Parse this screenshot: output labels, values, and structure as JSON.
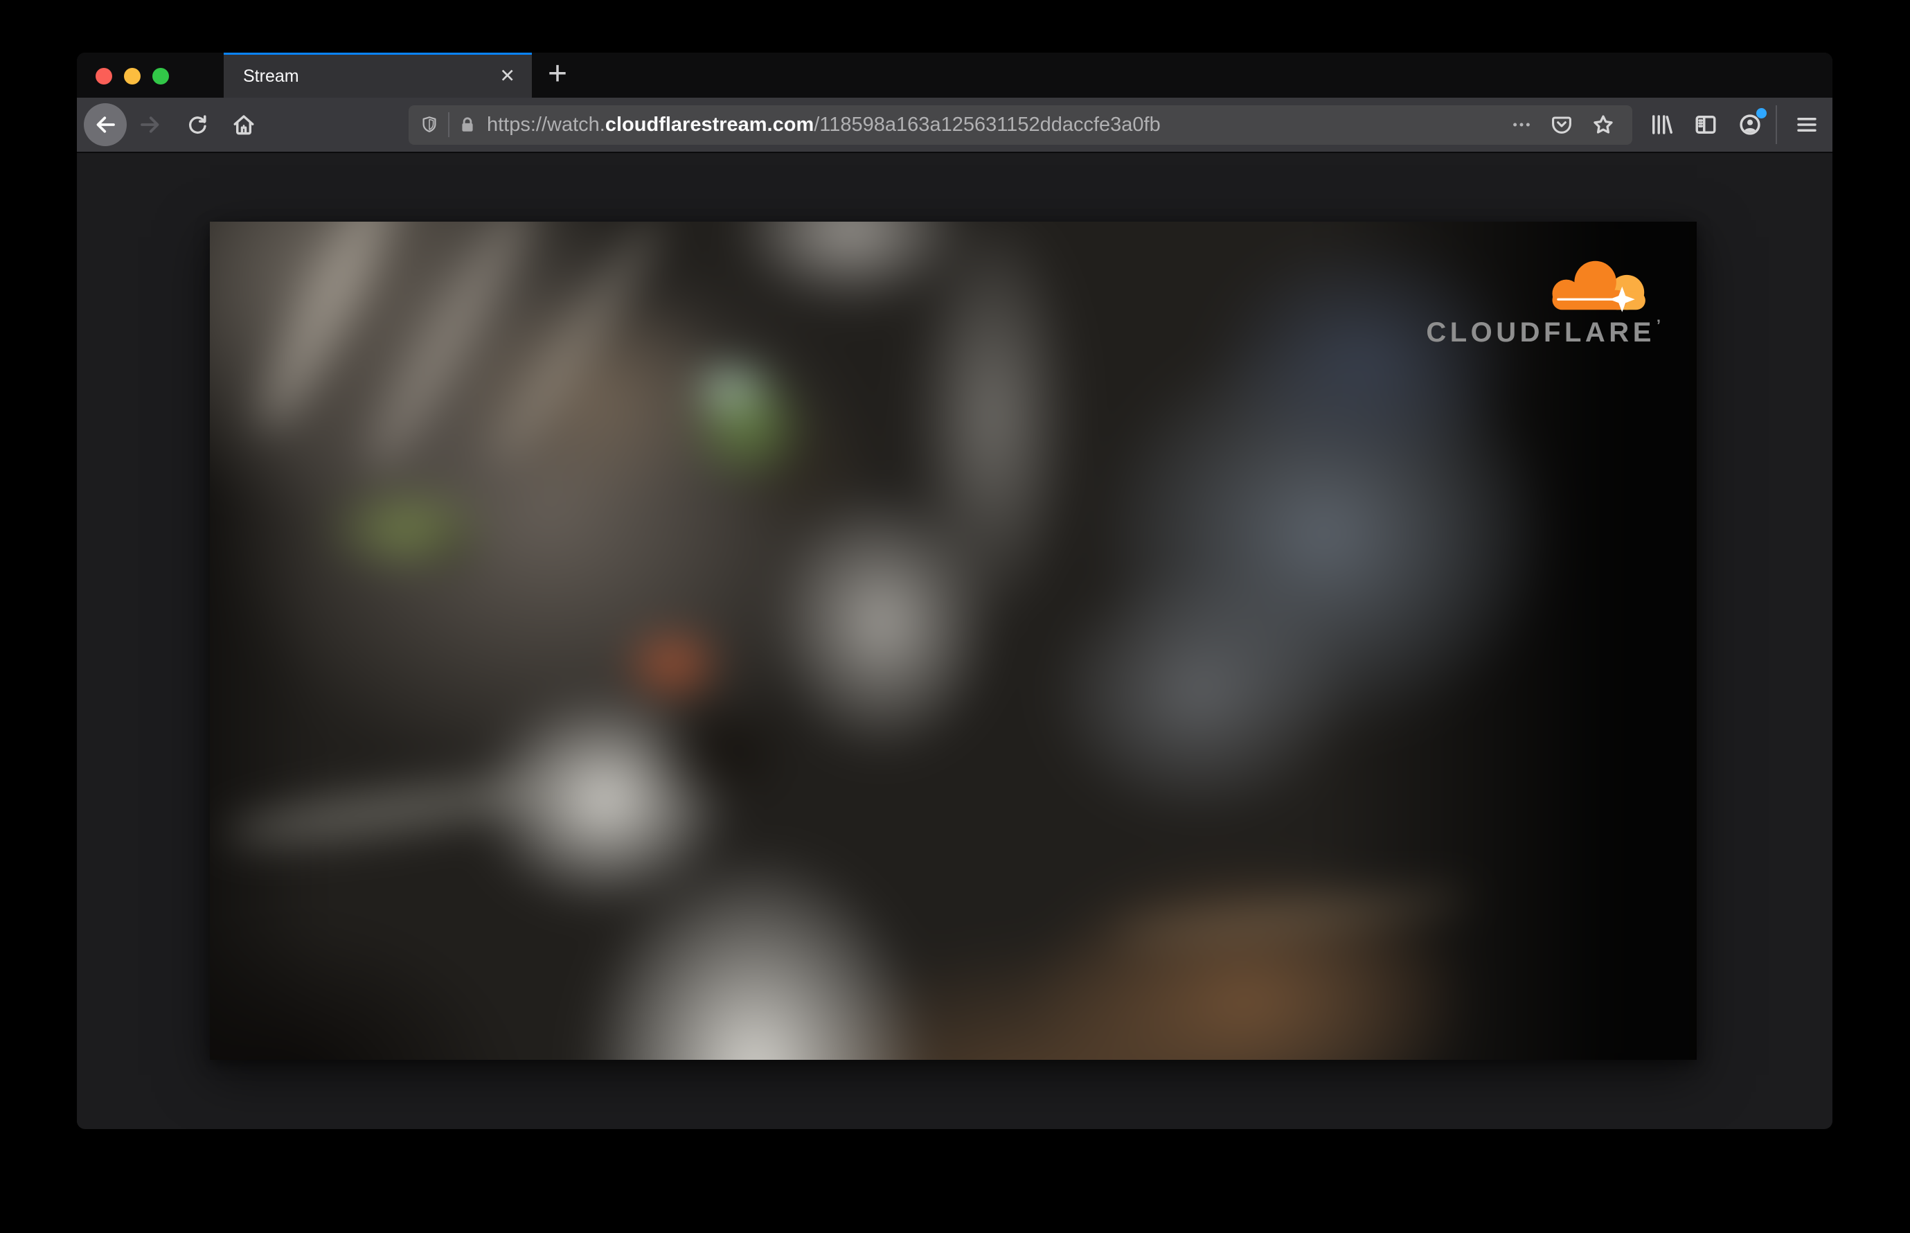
{
  "browser": {
    "tab": {
      "title": "Stream",
      "close_glyph": "✕",
      "new_tab_glyph": "+"
    },
    "address_bar": {
      "url_prefix": "https://watch.",
      "url_domain": "cloudflarestream.com",
      "url_path": "/118598a163a125631152ddaccfe3a0fb"
    },
    "icons": [
      "back-icon",
      "forward-icon",
      "reload-icon",
      "home-icon",
      "shield-icon",
      "lock-icon",
      "page-actions-dots-icon",
      "pocket-icon",
      "bookmark-star-icon",
      "library-icon",
      "sidebar-icon",
      "account-icon",
      "menu-hamburger-icon",
      "close-tab-icon",
      "new-tab-icon"
    ]
  },
  "player": {
    "brand_wordmark": "CLOUDFLARE",
    "brand_trademark": "’"
  },
  "colors": {
    "tab_accent_blue": "#0a84ff",
    "traffic_red": "#fb5f57",
    "traffic_yellow": "#fcbd3f",
    "traffic_green": "#32c748",
    "cloudflare_orange": "#f6821f",
    "cloudflare_orange_light": "#fbad41",
    "notification_dot_blue": "#2fa7ff",
    "toolbar_bg": "#39393d",
    "urlbar_bg": "#474749",
    "tabbar_bg": "#0d0d0e"
  }
}
